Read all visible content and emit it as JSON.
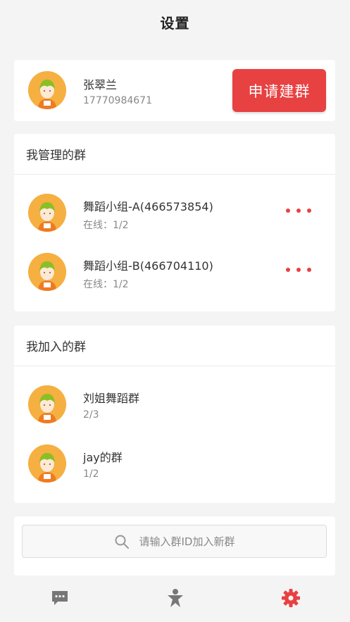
{
  "header": {
    "title": "设置"
  },
  "profile": {
    "name": "张翠兰",
    "phone": "17770984671",
    "apply_button": "申请建群"
  },
  "managed_groups": {
    "title": "我管理的群",
    "items": [
      {
        "name": "舞蹈小组-A(466573854)",
        "status": "在线：1/2"
      },
      {
        "name": "舞蹈小组-B(466704110)",
        "status": "在线：1/2"
      }
    ]
  },
  "joined_groups": {
    "title": "我加入的群",
    "items": [
      {
        "name": "刘姐舞蹈群",
        "count": "2/3"
      },
      {
        "name": "jay的群",
        "count": "1/2"
      }
    ]
  },
  "search": {
    "placeholder": "请输入群ID加入新群"
  },
  "tabbar": {
    "tabs": [
      {
        "icon": "message-icon",
        "active": false
      },
      {
        "icon": "person-star-icon",
        "active": false
      },
      {
        "icon": "gear-icon",
        "active": true
      }
    ]
  },
  "colors": {
    "accent": "#e84142",
    "background": "#f4f4f4",
    "inactive_icon": "#777777",
    "avatar_bg": "#f5b041"
  }
}
